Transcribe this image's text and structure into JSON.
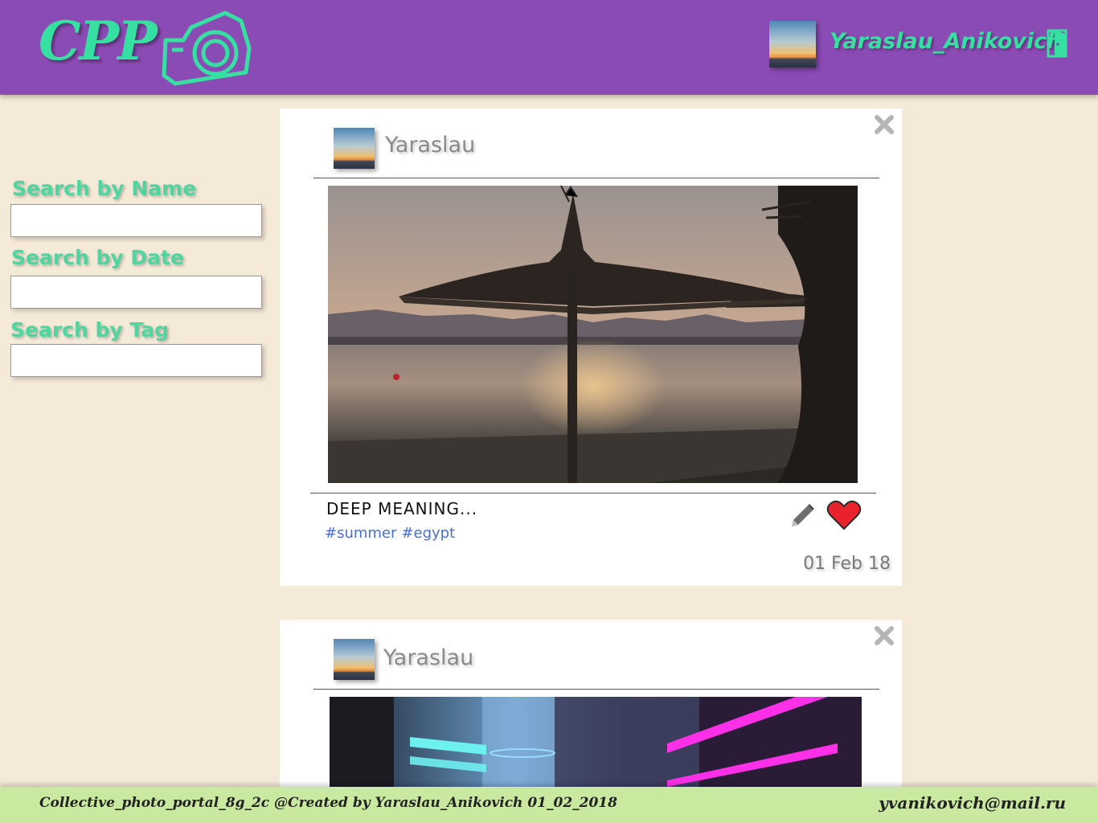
{
  "header": {
    "logo_text": "CPP",
    "user_name": "Yaraslau_Anikovich"
  },
  "search": {
    "name_label": "Search by Name",
    "date_label": "Search by Date",
    "tag_label": "Search by Tag",
    "name_value": "",
    "date_value": "",
    "tag_value": ""
  },
  "posts": [
    {
      "author": "Yaraslau",
      "caption": "DEEP MEANING...",
      "tags": [
        "#summer",
        "#egypt"
      ],
      "date": "01 Feb 18",
      "liked": true
    },
    {
      "author": "Yaraslau"
    }
  ],
  "icons": {
    "logo": "camera-icon",
    "logout": "door-exit-icon",
    "close": "close-x-icon",
    "edit": "pencil-icon",
    "like": "heart-icon"
  },
  "colors": {
    "header_bg": "#8b4bb5",
    "accent": "#35e0a0",
    "page_bg": "#f5e9d8",
    "footer_bg": "#c9e8a0",
    "tag": "#4a6fd0",
    "like": "#e8232e"
  },
  "footer": {
    "credit": "Collective_photo_portal_8g_2c @Created by Yaraslau_Anikovich 01_02_2018",
    "email": "yvanikovich@mail.ru"
  }
}
